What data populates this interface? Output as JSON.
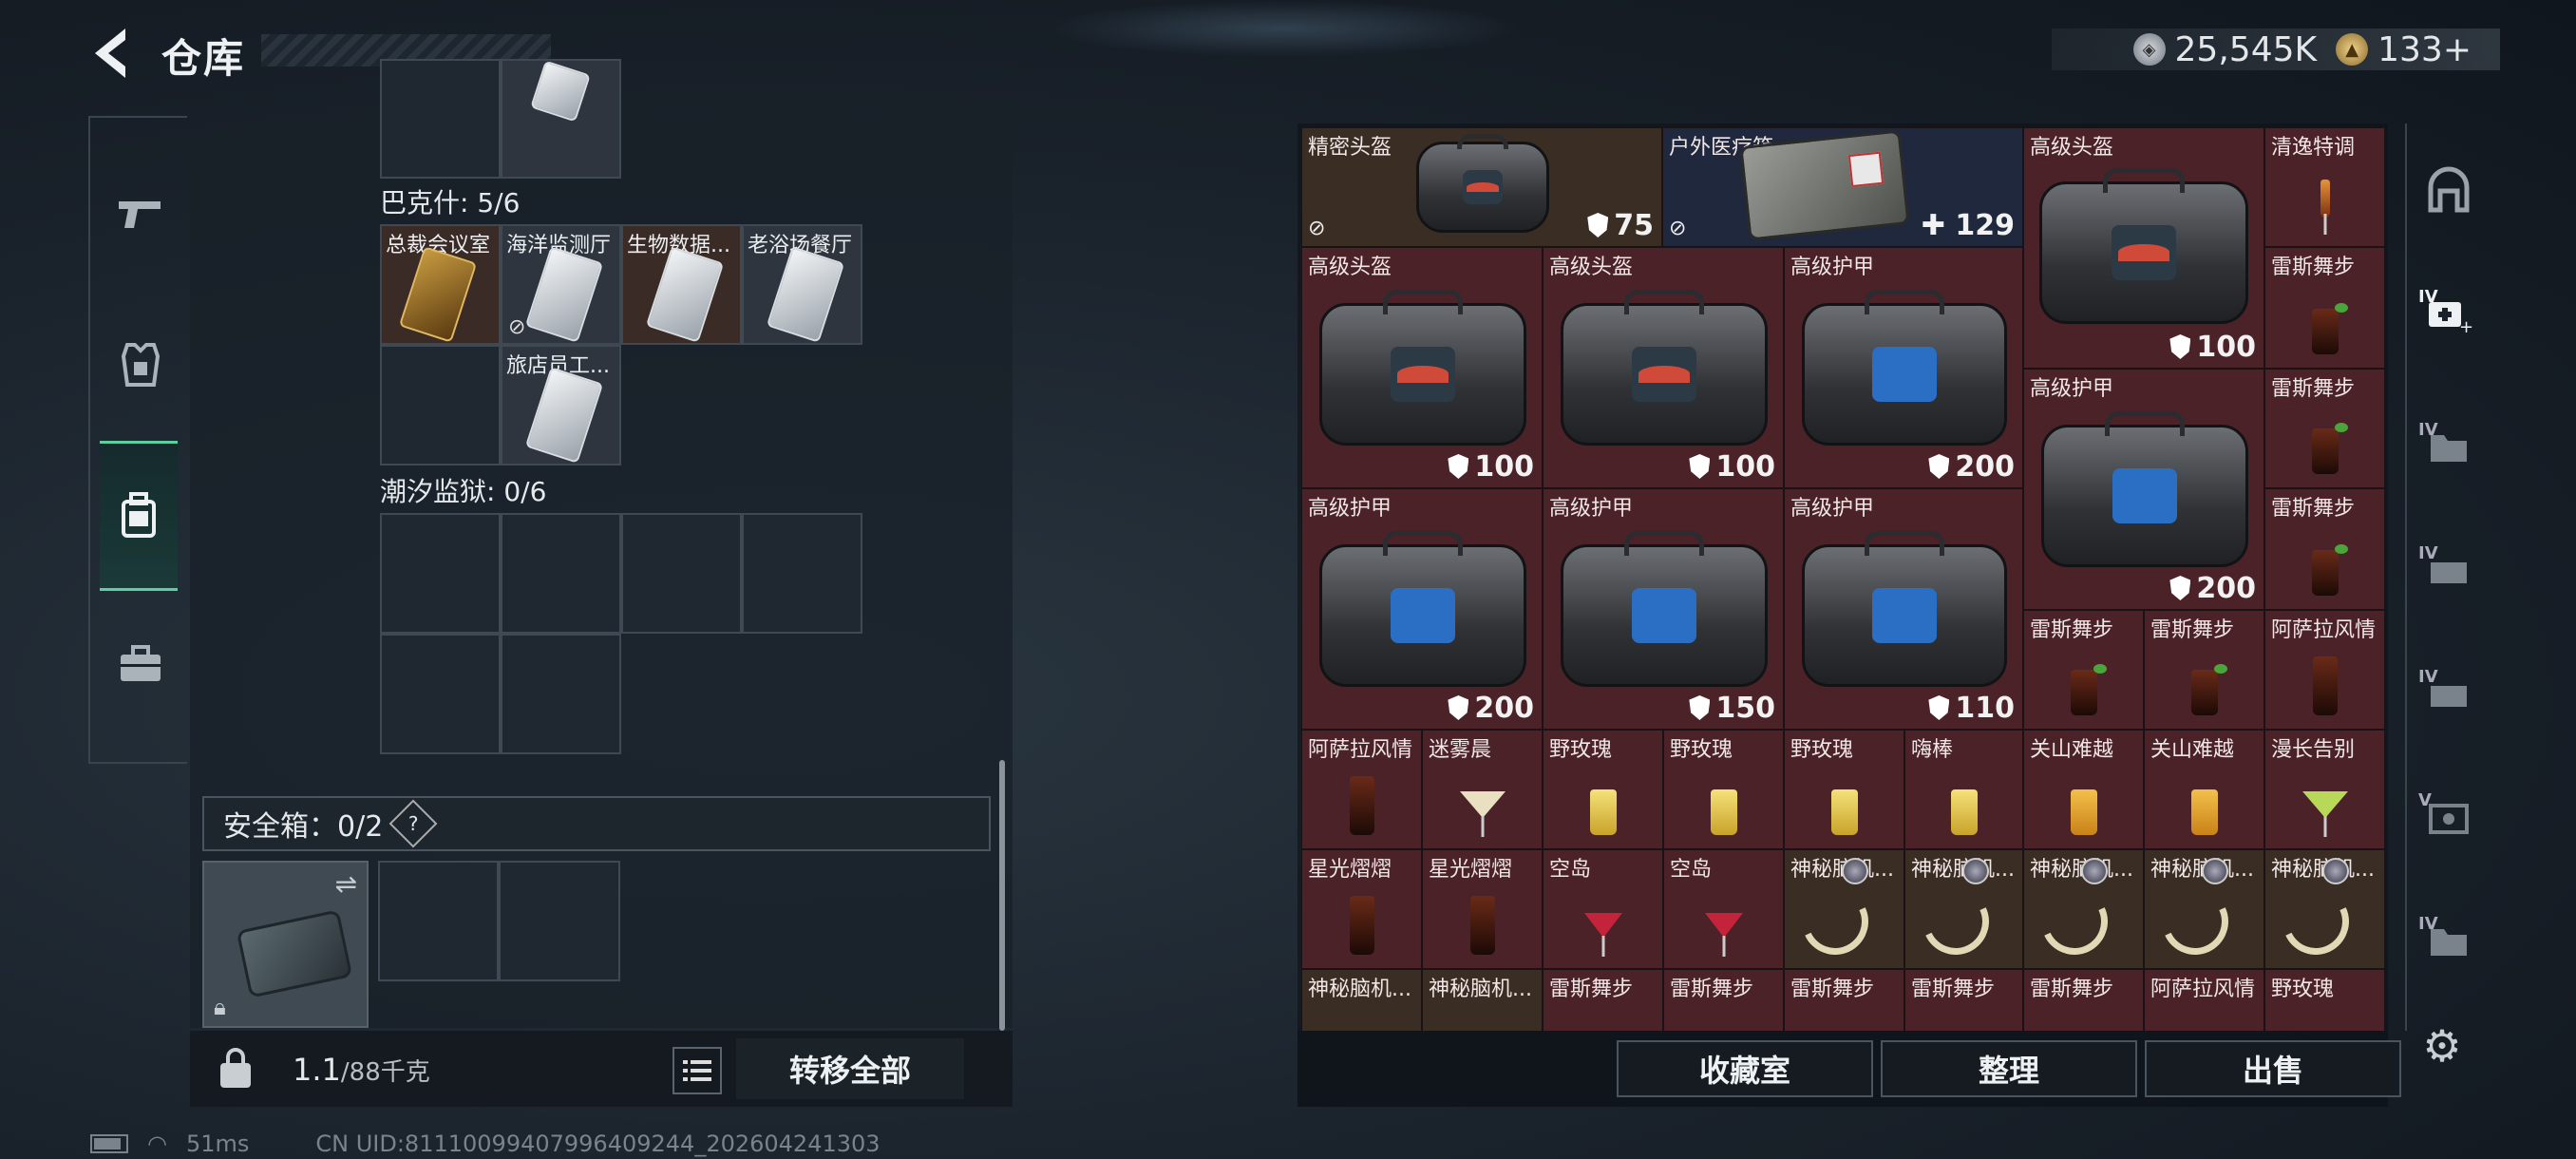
{
  "header": {
    "title": "仓库",
    "silver": "25,545K",
    "gold": "133+"
  },
  "left": {
    "section1": {
      "title": "巴克什: 5/6",
      "items": [
        "总裁会议室",
        "海洋监测厅",
        "生物数据...",
        "老浴场餐厅",
        "旅店员工..."
      ]
    },
    "section2": {
      "title": "潮汐监狱: 0/6"
    },
    "safe": {
      "label": "安全箱：0/2",
      "help": "?"
    },
    "weight": {
      "current": "1.1",
      "max": "/88千克"
    },
    "move_all": "转移全部"
  },
  "right": {
    "items": [
      {
        "name": "精密头盔",
        "value": "75"
      },
      {
        "name": "户外医疗箱",
        "value": "129"
      },
      {
        "name": "高级头盔",
        "value": "100"
      },
      {
        "name": "清逸特调"
      },
      {
        "name": "高级头盔",
        "value": "100"
      },
      {
        "name": "高级头盔",
        "value": "100"
      },
      {
        "name": "高级护甲",
        "value": "200"
      },
      {
        "name": "雷斯舞步"
      },
      {
        "name": "高级护甲",
        "value": "200"
      },
      {
        "name": "雷斯舞步"
      },
      {
        "name": "高级护甲",
        "value": "200"
      },
      {
        "name": "高级护甲",
        "value": "150"
      },
      {
        "name": "高级护甲",
        "value": "110"
      },
      {
        "name": "雷斯舞步"
      },
      {
        "name": "雷斯舞步"
      },
      {
        "name": "雷斯舞步"
      },
      {
        "name": "阿萨拉风情"
      },
      {
        "name": "阿萨拉风情"
      },
      {
        "name": "迷雾晨"
      },
      {
        "name": "野玫瑰"
      },
      {
        "name": "野玫瑰"
      },
      {
        "name": "野玫瑰"
      },
      {
        "name": "嗨棒"
      },
      {
        "name": "关山难越"
      },
      {
        "name": "关山难越"
      },
      {
        "name": "漫长告别"
      },
      {
        "name": "星光熠熠"
      },
      {
        "name": "星光熠熠"
      },
      {
        "name": "空岛"
      },
      {
        "name": "空岛"
      },
      {
        "name": "神秘脑机..."
      },
      {
        "name": "神秘脑机..."
      },
      {
        "name": "神秘脑机..."
      },
      {
        "name": "神秘脑机..."
      },
      {
        "name": "神秘脑机..."
      },
      {
        "name": "神秘脑机..."
      },
      {
        "name": "神秘脑机..."
      },
      {
        "name": "雷斯舞步"
      },
      {
        "name": "雷斯舞步"
      },
      {
        "name": "雷斯舞步"
      },
      {
        "name": "雷斯舞步"
      },
      {
        "name": "雷斯舞步"
      },
      {
        "name": "阿萨拉风情"
      },
      {
        "name": "野玫瑰"
      }
    ],
    "buttons": {
      "collection": "收藏室",
      "sort": "整理",
      "sell": "出售"
    }
  },
  "status": {
    "ping": "51ms",
    "uid": "CN UID:81110099407996409244_202604241303"
  },
  "side_tags": {
    "t1": "IV",
    "t2": "IV",
    "t3": "IV",
    "t4": "IV",
    "t5": "V",
    "t6": "IV"
  }
}
